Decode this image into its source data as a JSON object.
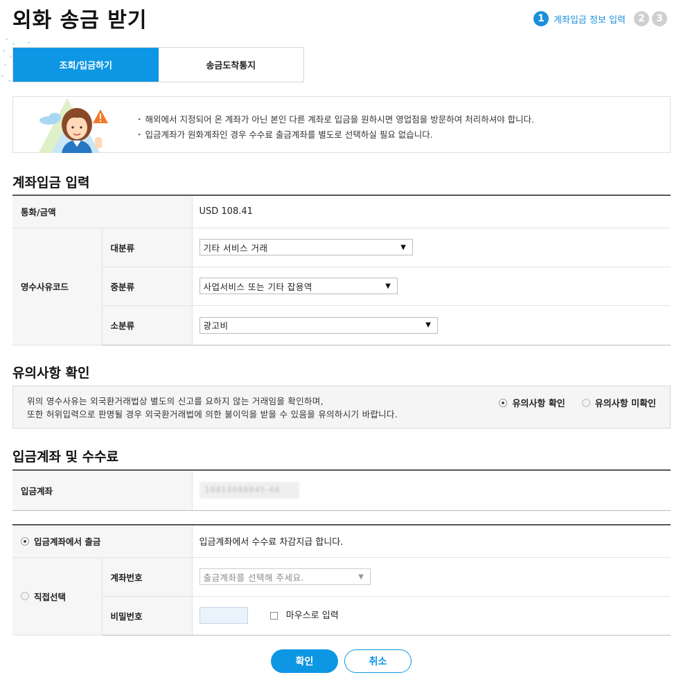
{
  "page": {
    "title": "외화 송금 받기"
  },
  "steps": [
    {
      "num": "1",
      "label": "계좌입금 정보 입력"
    },
    {
      "num": "2"
    },
    {
      "num": "3"
    }
  ],
  "tabs": [
    {
      "label": "조회/입금하기",
      "active": true
    },
    {
      "label": "송금도착통지",
      "active": false
    }
  ],
  "notice": {
    "lines": [
      "해외에서 지정되어 온 계좌가 아닌 본인 다른 계좌로 입금을 원하시면 영업점을 방문하여 처리하셔야 합니다.",
      "입금계좌가 원화계좌인 경우 수수료 출금계좌를 별도로 선택하실 필요 없습니다."
    ]
  },
  "account_input": {
    "title": "계좌입금 입력",
    "currency_label": "통화/금액",
    "currency_value": "USD 108.41",
    "reason_code_label": "영수사유코드",
    "major_label": "대분류",
    "major_value": "기타 서비스 거래",
    "middle_label": "중분류",
    "middle_value": "사업서비스 또는 기타 잡용역",
    "minor_label": "소분류",
    "minor_value": "광고비"
  },
  "caution": {
    "title": "유의사항 확인",
    "text_line1": "위의 영수사유는 외국환거래법상 별도의 신고를 요하지 않는 거래임을 확인하며,",
    "text_line2": "또한 허위입력으로 판명될 경우 외국환거래법에 의한 불이익을 받을 수 있음을 유의하시기 바랍니다.",
    "option_confirm": "유의사항 확인",
    "option_unconfirm": "유의사항 미확인",
    "selected": "confirm"
  },
  "deposit": {
    "title": "입금계좌 및 수수료",
    "account_label": "입금계좌",
    "account_value": "18814088845-46"
  },
  "fee": {
    "option_from_deposit": "입금계좌에서 출금",
    "option_from_deposit_desc": "입금계좌에서 수수료 차감지급 합니다.",
    "option_direct": "직접선택",
    "account_no_label": "계좌번호",
    "account_placeholder": "출금계좌를 선택해 주세요.",
    "password_label": "비밀번호",
    "mouse_input_label": "마우스로 입력",
    "selected": "from_deposit"
  },
  "buttons": {
    "ok": "확인",
    "cancel": "취소"
  },
  "colors": {
    "accent": "#0d96e3",
    "step_active": "#1a8fdc",
    "step_inactive": "#cfcfcf"
  }
}
